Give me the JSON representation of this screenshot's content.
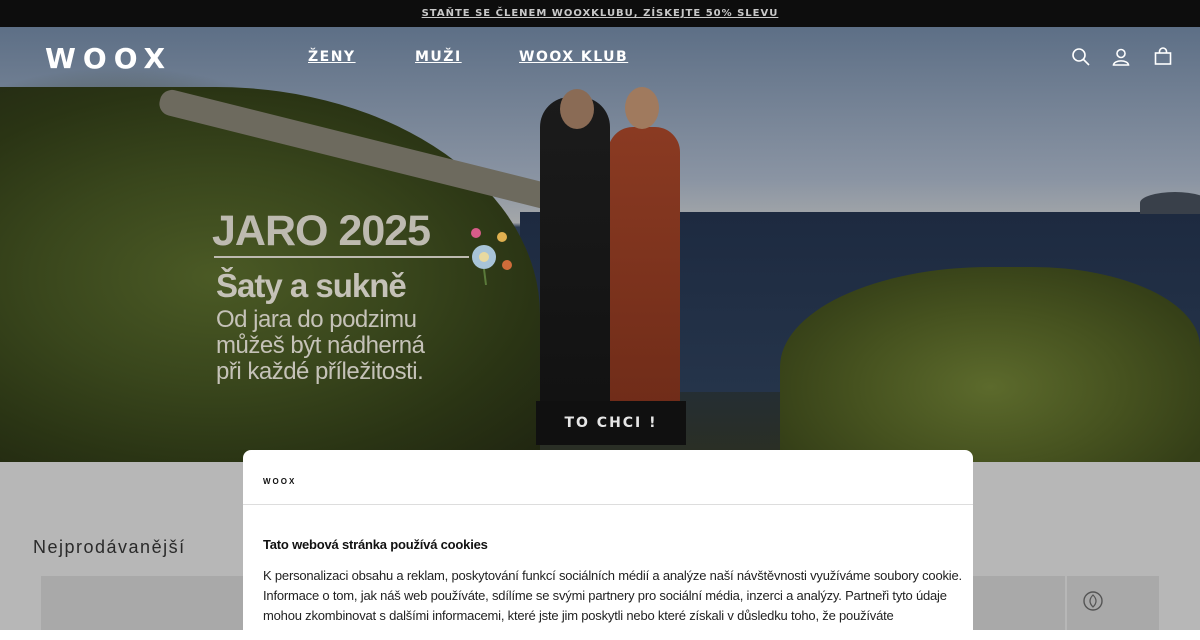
{
  "promo": {
    "text": "STAŇTE SE ČLENEM WOOXKLUBU, ZÍSKEJTE 50% SLEVU"
  },
  "header": {
    "logo": "WOOX",
    "nav": [
      "ŽENY",
      "MUŽI",
      "WOOX KLUB"
    ],
    "icons": [
      "search-icon",
      "account-icon",
      "bag-icon"
    ]
  },
  "hero": {
    "title": "JARO 2025",
    "subtitle": "Šaty a sukně",
    "body_lines": [
      "Od jara do podzimu",
      "můžeš být nádherná",
      "při každé příležitosti."
    ],
    "cta": "TO CHCI !",
    "slides": 3,
    "active_slide": 1
  },
  "section": {
    "title": "Nejprodávanější"
  },
  "cookie": {
    "brand": "WOOX",
    "title": "Tato webová stránka používá cookies",
    "text": "K personalizaci obsahu a reklam, poskytování funkcí sociálních médií a analýze naší návštěvnosti využíváme soubory cookie. Informace o tom, jak náš web používáte, sdílíme se svými partnery pro sociální média, inzerci a analýzy. Partneři tyto údaje mohou zkombinovat s dalšími informacemi, které jste jim poskytli nebo které získali v důsledku toho, že používáte"
  },
  "colors": {
    "promo_bg": "#0d0d0d",
    "cta_bg": "#101010",
    "overlay": "#b7b7b7"
  }
}
